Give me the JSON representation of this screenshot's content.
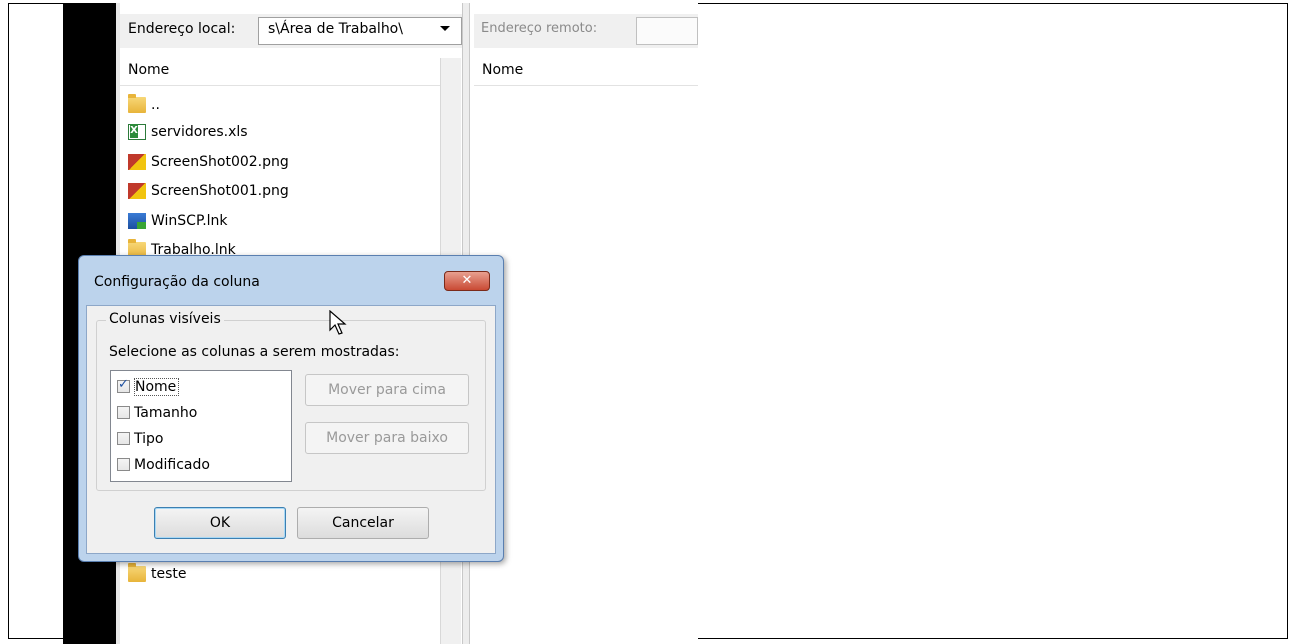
{
  "local": {
    "address_label": "Endereço local:",
    "address_value": "s\\Área de Trabalho\\",
    "column_name": "Nome",
    "files": [
      {
        "name": "..",
        "icon": "folder-up-icon"
      },
      {
        "name": "servidores.xls",
        "icon": "excel-file-icon"
      },
      {
        "name": "ScreenShot002.png",
        "icon": "image-file-icon"
      },
      {
        "name": "ScreenShot001.png",
        "icon": "image-file-icon"
      },
      {
        "name": "WinSCP.lnk",
        "icon": "shortcut-icon"
      },
      {
        "name": "Trabalho.lnk",
        "icon": "folder-icon"
      },
      {
        "name": "teste",
        "icon": "folder-icon"
      }
    ]
  },
  "remote": {
    "address_label": "Endereço remoto:",
    "column_name": "Nome"
  },
  "dialog": {
    "title": "Configuração da coluna",
    "close_symbol": "✕",
    "group_label": "Colunas visíveis",
    "instruction": "Selecione as colunas a serem mostradas:",
    "columns": [
      {
        "label": "Nome",
        "checked": true
      },
      {
        "label": "Tamanho",
        "checked": false
      },
      {
        "label": "Tipo",
        "checked": false
      },
      {
        "label": "Modificado",
        "checked": false
      }
    ],
    "move_up_label": "Mover para cima",
    "move_down_label": "Mover para baixo",
    "ok_label": "OK",
    "cancel_label": "Cancelar"
  },
  "colors": {
    "dialog_frame": "#bcd3ec",
    "close_button": "#c94a34",
    "check_mark": "#1c4fa0"
  }
}
